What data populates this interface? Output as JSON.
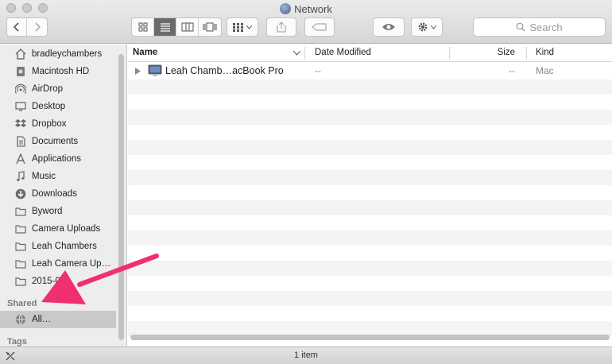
{
  "window": {
    "title": "Network"
  },
  "toolbar": {
    "back_icon": "chevron-left-icon",
    "forward_icon": "chevron-right-icon",
    "view_modes": [
      "icon-view-icon",
      "list-view-icon",
      "column-view-icon",
      "cover-flow-icon"
    ],
    "active_view": "list",
    "search_placeholder": "Search"
  },
  "sidebar": {
    "favorites": [
      {
        "label": "bradleychambers",
        "icon": "home-icon"
      },
      {
        "label": "Macintosh HD",
        "icon": "hard-drive-icon"
      },
      {
        "label": "AirDrop",
        "icon": "airdrop-icon"
      },
      {
        "label": "Desktop",
        "icon": "desktop-icon"
      },
      {
        "label": "Dropbox",
        "icon": "dropbox-icon"
      },
      {
        "label": "Documents",
        "icon": "documents-icon"
      },
      {
        "label": "Applications",
        "icon": "applications-icon"
      },
      {
        "label": "Music",
        "icon": "music-icon"
      },
      {
        "label": "Downloads",
        "icon": "downloads-icon"
      },
      {
        "label": "Byword",
        "icon": "folder-icon"
      },
      {
        "label": "Camera Uploads",
        "icon": "folder-icon"
      },
      {
        "label": "Leah Chambers",
        "icon": "folder-icon"
      },
      {
        "label": "Leah Camera Up…",
        "icon": "folder-icon"
      },
      {
        "label": "2015-0",
        "icon": "folder-icon"
      }
    ],
    "shared_heading": "Shared",
    "shared": [
      {
        "label": "All…",
        "icon": "network-icon",
        "selected": true
      }
    ],
    "tags_heading": "Tags"
  },
  "list": {
    "columns": {
      "name": "Name",
      "date": "Date Modified",
      "size": "Size",
      "kind": "Kind"
    },
    "rows": [
      {
        "name": "Leah Chamb…acBook Pro",
        "date": "--",
        "size": "--",
        "kind": "Mac",
        "icon": "imac-icon"
      }
    ]
  },
  "status": {
    "text": "1 item"
  },
  "colors": {
    "annotation_arrow": "#f0306e"
  }
}
